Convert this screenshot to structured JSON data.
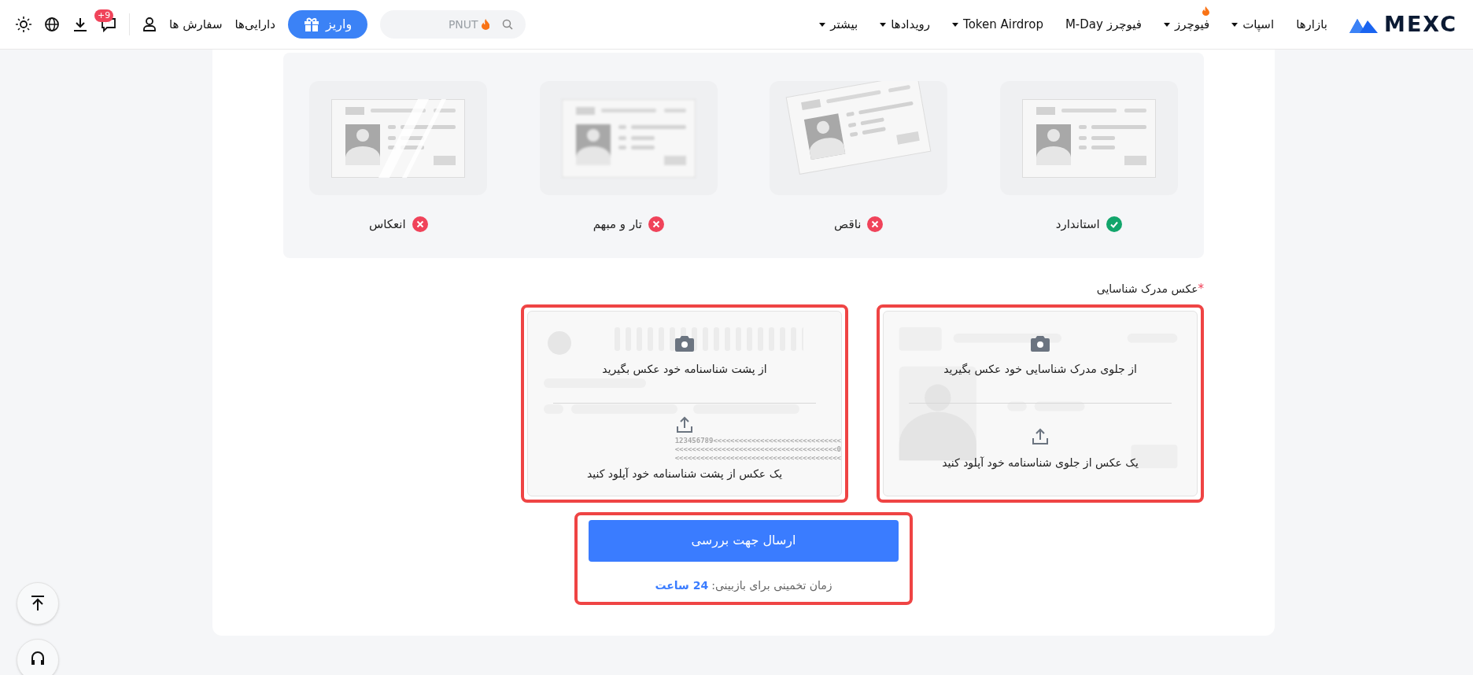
{
  "header": {
    "logo": "MEXC",
    "nav": [
      {
        "label": "بازارها",
        "caret": false,
        "flame": false
      },
      {
        "label": "اسپات",
        "caret": true,
        "flame": false
      },
      {
        "label": "فیوچرز",
        "caret": true,
        "flame": true
      },
      {
        "label": "فیوچرز M-Day",
        "caret": false,
        "flame": false
      },
      {
        "label": "Token Airdrop",
        "caret": true,
        "flame": false
      },
      {
        "label": "رویدادها",
        "caret": true,
        "flame": false
      },
      {
        "label": "بیشتر",
        "caret": true,
        "flame": false
      }
    ],
    "search": {
      "placeholder": "PNUT"
    },
    "deposit": "واریز",
    "links": [
      "دارایی‌ها",
      "سفارش ها"
    ],
    "badge": "+9"
  },
  "examples": [
    {
      "label": "استاندارد",
      "ok": true,
      "kind": "standard"
    },
    {
      "label": "ناقص",
      "ok": false,
      "kind": "tilted"
    },
    {
      "label": "تار و مبهم",
      "ok": false,
      "kind": "blurred"
    },
    {
      "label": "انعکاس",
      "ok": false,
      "kind": "glare"
    }
  ],
  "upload": {
    "label": "عکس مدرک شناسایی",
    "required_mark": "*",
    "boxes": [
      {
        "kind": "front",
        "highlighted": true,
        "capture": "از جلوی مدرک شناسایی خود عکس بگیرید",
        "upload": "یک عکس از جلوی شناسنامه خود آپلود کنید"
      },
      {
        "kind": "back",
        "highlighted": true,
        "capture": "از پشت شناسنامه خود عکس بگیرید",
        "upload": "یک عکس از پشت شناسنامه خود آپلود کنید",
        "mrz": [
          "123456789<<<<<<<<<<<<<<<<<<<<<<<<<<<<<<",
          "<<<<<<<<<<<<<<<<<<<<<<<<<<<<<<<<<<<<<<0",
          "<<<<<<<<<<<<<<<<<<<<<<<<<<<<<<<<<<<<<<<"
        ]
      }
    ]
  },
  "submit": {
    "button": "ارسال جهت بررسی",
    "eta_label": "زمان تخمینی برای بازبینی:",
    "eta_value": "24 ساعت",
    "highlighted": true
  }
}
